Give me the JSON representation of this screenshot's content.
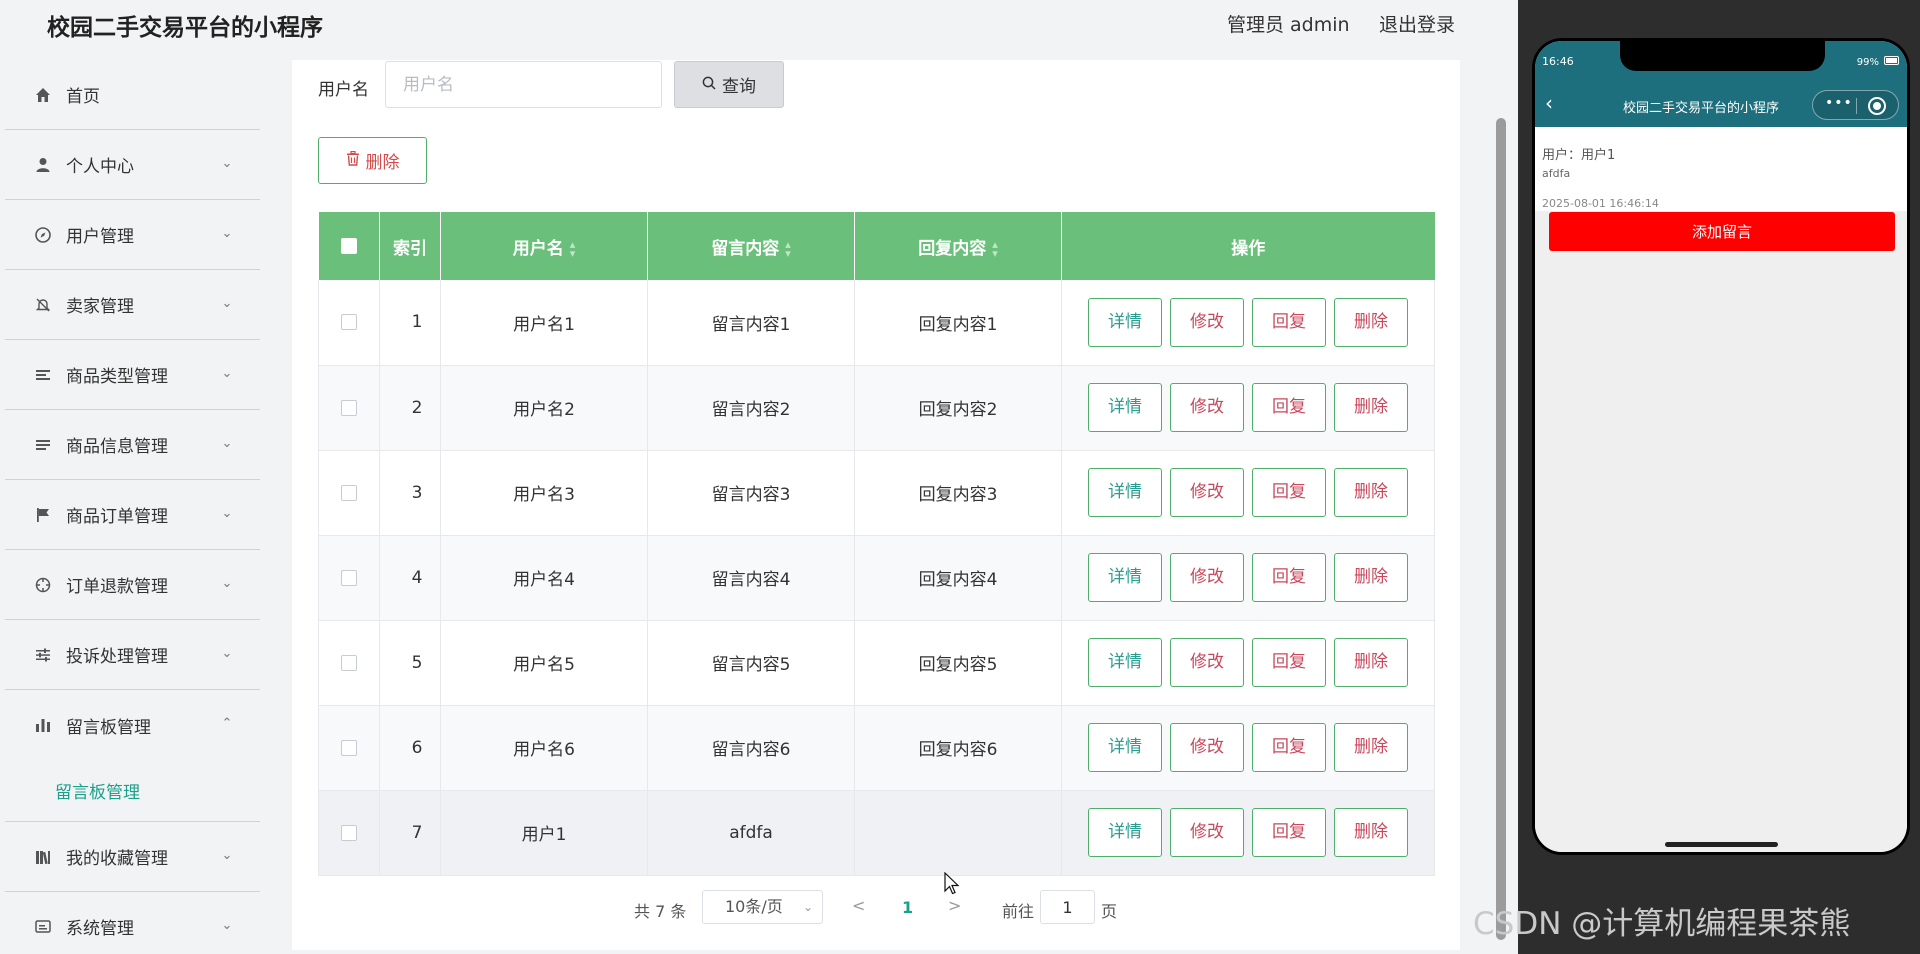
{
  "app": {
    "title": "校园二手交易平台的小程序",
    "admin": "管理员 admin",
    "logout": "退出登录"
  },
  "sidebar": {
    "items": [
      {
        "label": "首页",
        "icon": "home-icon",
        "expanded": null
      },
      {
        "label": "个人中心",
        "icon": "user-icon",
        "expanded": false
      },
      {
        "label": "用户管理",
        "icon": "compass-icon",
        "expanded": false
      },
      {
        "label": "卖家管理",
        "icon": "bell-off-icon",
        "expanded": false
      },
      {
        "label": "商品类型管理",
        "icon": "list-icon",
        "expanded": false
      },
      {
        "label": "商品信息管理",
        "icon": "list-icon",
        "expanded": false
      },
      {
        "label": "商品订单管理",
        "icon": "flag-icon",
        "expanded": false
      },
      {
        "label": "订单退款管理",
        "icon": "crosshair-icon",
        "expanded": false
      },
      {
        "label": "投诉处理管理",
        "icon": "sliders-icon",
        "expanded": false
      },
      {
        "label": "留言板管理",
        "icon": "bar-chart-icon",
        "expanded": true
      },
      {
        "label": "我的收藏管理",
        "icon": "books-icon",
        "expanded": false
      },
      {
        "label": "系统管理",
        "icon": "message-icon",
        "expanded": false
      }
    ],
    "active_subitem": "留言板管理"
  },
  "search": {
    "label": "用户名",
    "placeholder": "用户名",
    "value": "",
    "button": "查询"
  },
  "toolbar": {
    "delete": "删除"
  },
  "table": {
    "headers": [
      "",
      "索引",
      "用户名",
      "留言内容",
      "回复内容",
      "操作"
    ],
    "rows": [
      {
        "index": "1",
        "username": "用户名1",
        "message": "留言内容1",
        "reply": "回复内容1"
      },
      {
        "index": "2",
        "username": "用户名2",
        "message": "留言内容2",
        "reply": "回复内容2"
      },
      {
        "index": "3",
        "username": "用户名3",
        "message": "留言内容3",
        "reply": "回复内容3"
      },
      {
        "index": "4",
        "username": "用户名4",
        "message": "留言内容4",
        "reply": "回复内容4"
      },
      {
        "index": "5",
        "username": "用户名5",
        "message": "留言内容5",
        "reply": "回复内容5"
      },
      {
        "index": "6",
        "username": "用户名6",
        "message": "留言内容6",
        "reply": "回复内容6"
      },
      {
        "index": "7",
        "username": "用户1",
        "message": "afdfa",
        "reply": ""
      }
    ],
    "actions": {
      "detail": "详情",
      "edit": "修改",
      "reply": "回复",
      "delete": "删除"
    }
  },
  "pagination": {
    "total": "共 7 条",
    "page_size": "10条/页",
    "prev": "<",
    "current": "1",
    "next": ">",
    "goto_label": "前往",
    "goto_value": "1",
    "page_suffix": "页"
  },
  "phone": {
    "status_time": "16:46",
    "battery": "99%",
    "nav_title": "校园二手交易平台的小程序",
    "entry": {
      "user": "用户：用户1",
      "content": "afdfa",
      "date": "2025-08-01 16:46:14"
    },
    "add_button": "添加留言"
  },
  "watermark": "CSDN @计算机编程果茶熊",
  "colors": {
    "header_green": "#6ac07b",
    "accent_teal": "#1aa08b",
    "phone_bar": "#1e6f7d",
    "add_button_red": "#ff0000"
  }
}
